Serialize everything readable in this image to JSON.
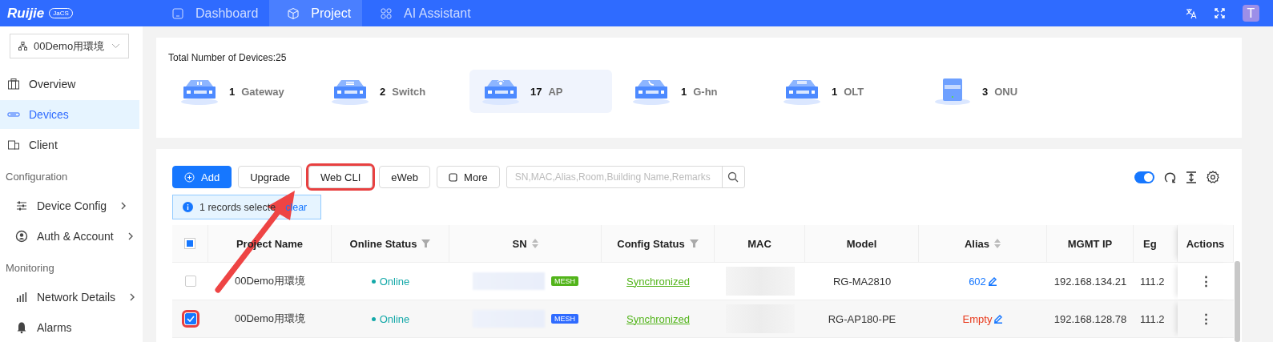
{
  "topbar": {
    "logo": {
      "name": "Ruijie",
      "badge": "JaCS"
    },
    "tabs": [
      {
        "label": "Dashboard",
        "selected": false
      },
      {
        "label": "Project",
        "selected": true
      },
      {
        "label": "AI Assistant",
        "selected": false
      }
    ],
    "avatar": "T"
  },
  "sidebar": {
    "project_select": {
      "value": "00Demo用環境"
    },
    "sections": [
      {
        "items": [
          {
            "label": "Overview",
            "selected": false,
            "has_submenu": false
          },
          {
            "label": "Devices",
            "selected": true,
            "has_submenu": false
          },
          {
            "label": "Client",
            "selected": false,
            "has_submenu": false
          }
        ]
      },
      {
        "title": "Configuration",
        "items": [
          {
            "label": "Device Config",
            "selected": false,
            "has_submenu": true
          },
          {
            "label": "Auth & Account",
            "selected": false,
            "has_submenu": true
          }
        ]
      },
      {
        "title": "Monitoring",
        "items": [
          {
            "label": "Network Details",
            "selected": false,
            "has_submenu": true
          },
          {
            "label": "Alarms",
            "selected": false,
            "has_submenu": false
          }
        ]
      }
    ]
  },
  "summary": {
    "title": "Total Number of Devices:25",
    "device_types": [
      {
        "kind": "gateway",
        "count": "1",
        "label": "Gateway",
        "selected": false
      },
      {
        "kind": "switch",
        "count": "2",
        "label": "Switch",
        "selected": false
      },
      {
        "kind": "ap",
        "count": "17",
        "label": "AP",
        "selected": true
      },
      {
        "kind": "ghn",
        "count": "1",
        "label": "G-hn",
        "selected": false
      },
      {
        "kind": "olt",
        "count": "1",
        "label": "OLT",
        "selected": false
      },
      {
        "kind": "onu",
        "count": "3",
        "label": "ONU",
        "selected": false
      }
    ]
  },
  "toolbar": {
    "buttons": [
      {
        "label": "Add",
        "kind": "primary",
        "annotated": false
      },
      {
        "label": "Upgrade",
        "kind": "default",
        "annotated": false
      },
      {
        "label": "Web CLI",
        "kind": "default",
        "annotated": true
      },
      {
        "label": "eWeb",
        "kind": "default",
        "annotated": false
      },
      {
        "label": "More",
        "kind": "more",
        "annotated": false
      }
    ],
    "search": {
      "placeholder": "SN,MAC,Alias,Room,Building Name,Remarks"
    },
    "auto_refresh_toggle": {
      "on": true
    }
  },
  "selection_alert": {
    "text": "1 records selecte",
    "link": "clear"
  },
  "table": {
    "select_all": {
      "indeterminate": true
    },
    "columns": [
      {
        "label": "Project Name",
        "sortable": false,
        "filterable": false
      },
      {
        "label": "Online Status",
        "sortable": false,
        "filterable": true
      },
      {
        "label": "SN",
        "sortable": true,
        "filterable": false
      },
      {
        "label": "Config Status",
        "sortable": false,
        "filterable": true
      },
      {
        "label": "MAC",
        "sortable": false,
        "filterable": false
      },
      {
        "label": "Model",
        "sortable": false,
        "filterable": false
      },
      {
        "label": "Alias",
        "sortable": true,
        "filterable": false
      },
      {
        "label": "MGMT IP",
        "sortable": false,
        "filterable": false
      },
      {
        "label": "Eg",
        "sortable": false,
        "filterable": false
      },
      {
        "label": "Actions",
        "sortable": false,
        "filterable": false
      }
    ],
    "rows": [
      {
        "checked": false,
        "annotated": false,
        "project_name": "00Demo用環境",
        "online_status": "Online",
        "sn_badge": {
          "text": "MESH",
          "color": "#52b41a"
        },
        "config_status": "Synchronized",
        "model": "RG-MA2810",
        "alias": {
          "text": "602",
          "empty": false
        },
        "mgmt_ip": "192.168.134.21",
        "column_9": "111.2",
        "actions": "⋮"
      },
      {
        "checked": true,
        "annotated": true,
        "project_name": "00Demo用環境",
        "online_status": "Online",
        "sn_badge": {
          "text": "MESH",
          "color": "#2f6bff"
        },
        "config_status": "Synchronized",
        "model": "RG-AP180-PE",
        "alias": {
          "text": "Empty",
          "empty": true
        },
        "mgmt_ip": "192.168.128.78",
        "column_9": "111.2",
        "actions": "⋮"
      }
    ]
  }
}
